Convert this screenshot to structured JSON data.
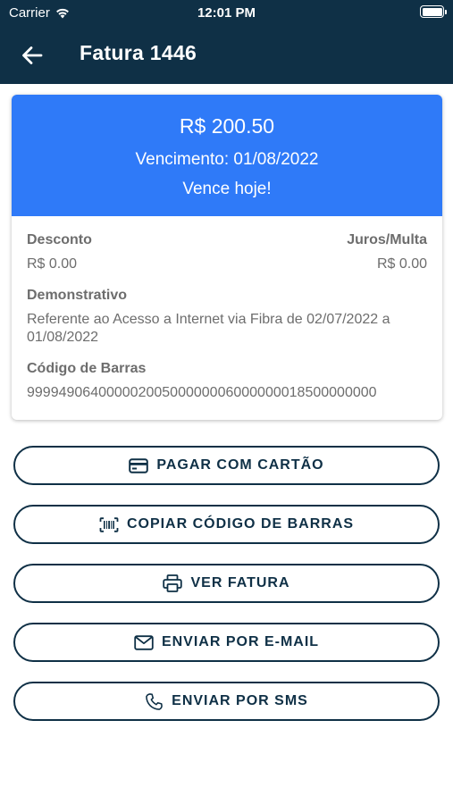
{
  "status_bar": {
    "carrier": "Carrier",
    "time": "12:01 PM"
  },
  "header": {
    "title": "Fatura 1446"
  },
  "invoice": {
    "amount": "R$ 200.50",
    "due_date": "Vencimento: 01/08/2022",
    "due_status": "Vence hoje!",
    "discount_label": "Desconto",
    "discount_value": "R$ 0.00",
    "interest_label": "Juros/Multa",
    "interest_value": "R$ 0.00",
    "statement_label": "Demonstrativo",
    "statement_value": "Referente ao Acesso a Internet via Fibra de 02/07/2022 a 01/08/2022",
    "barcode_label": "Código de Barras",
    "barcode_value": "99994906400000200500000006000000018500000000"
  },
  "actions": {
    "pay_card": "PAGAR COM CARTÃO",
    "copy_barcode": "COPIAR CÓDIGO DE BARRAS",
    "view_invoice": "VER FATURA",
    "send_email": "ENVIAR POR E-MAIL",
    "send_sms": "ENVIAR POR SMS"
  },
  "colors": {
    "header_bg": "#0f3046",
    "card_accent": "#2f7af8",
    "button_border": "#0f3046"
  }
}
